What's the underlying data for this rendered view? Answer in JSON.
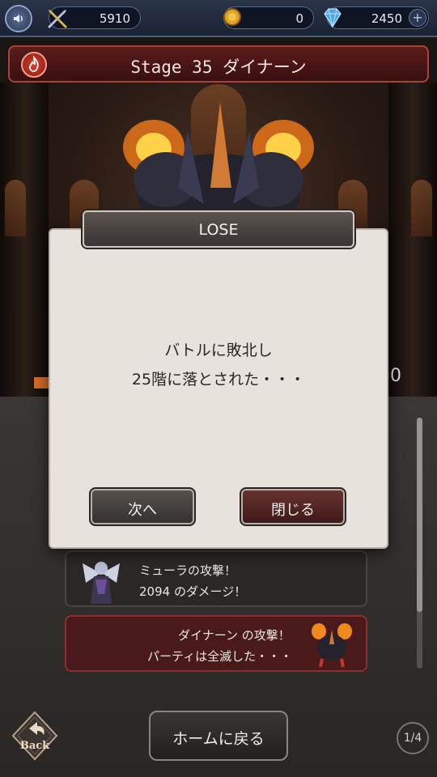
{
  "topbar": {
    "sword_value": "5910",
    "coin_value": "0",
    "gem_value": "2450",
    "gem_plus": "+"
  },
  "stage": {
    "title": "Stage 35 ダイナーン"
  },
  "scene": {
    "hp_number": "0"
  },
  "dialog": {
    "title": "LOSE",
    "message_line1": "バトルに敗北し",
    "message_line2": "25階に落とされた・・・",
    "next_label": "次へ",
    "close_label": "閉じる"
  },
  "battle_log": [
    {
      "line1": "ミューラの攻撃！",
      "line2": "2094 のダメージ！"
    },
    {
      "line1": "ダイナーン の攻撃！",
      "line2": "パーティは全滅した・・・"
    }
  ],
  "footer": {
    "home_label": "ホームに戻る",
    "back_label": "Back",
    "page_indicator": "1/4"
  },
  "colors": {
    "enemy_card": "#4a1a1a",
    "close_button": "#6a3330",
    "stage_banner": "#5a1c1c"
  }
}
